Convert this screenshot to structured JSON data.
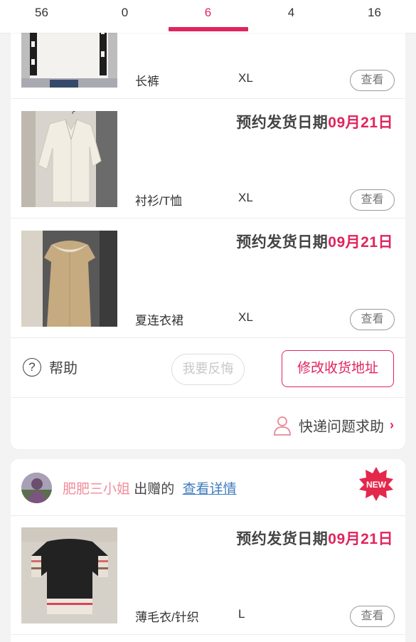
{
  "tabs": [
    {
      "label": "56",
      "active": false
    },
    {
      "label": "0",
      "active": false
    },
    {
      "label": "6",
      "active": true
    },
    {
      "label": "4",
      "active": false
    },
    {
      "label": "16",
      "active": false
    }
  ],
  "order1": {
    "items": [
      {
        "title_prefix": "",
        "date": "",
        "category": "长裤",
        "size": "XL",
        "view_label": "查看"
      },
      {
        "title_prefix": "预约发货日期",
        "date": "09月21日",
        "category": "衬衫/T恤",
        "size": "XL",
        "view_label": "查看"
      },
      {
        "title_prefix": "预约发货日期",
        "date": "09月21日",
        "category": "夏连衣裙",
        "size": "XL",
        "view_label": "查看"
      }
    ],
    "help_label": "帮助",
    "regret_label": "我要反悔",
    "change_address_label": "修改收货地址",
    "express_help_label": "快递问题求助"
  },
  "order2": {
    "giver_name": "肥肥三小姐",
    "gave_text": "出赠的",
    "detail_link": "查看详情",
    "new_badge": "NEW",
    "items": [
      {
        "title_prefix": "预约发货日期",
        "date": "09月21日",
        "category": "薄毛衣/针织",
        "size": "L",
        "view_label": "查看"
      }
    ]
  },
  "colors": {
    "accent": "#e0245e",
    "giver_name": "#f28c9a",
    "link": "#3e7bbd"
  },
  "icons": [
    "help-circle-icon",
    "person-icon",
    "chevron-right-icon",
    "new-starburst-icon"
  ]
}
